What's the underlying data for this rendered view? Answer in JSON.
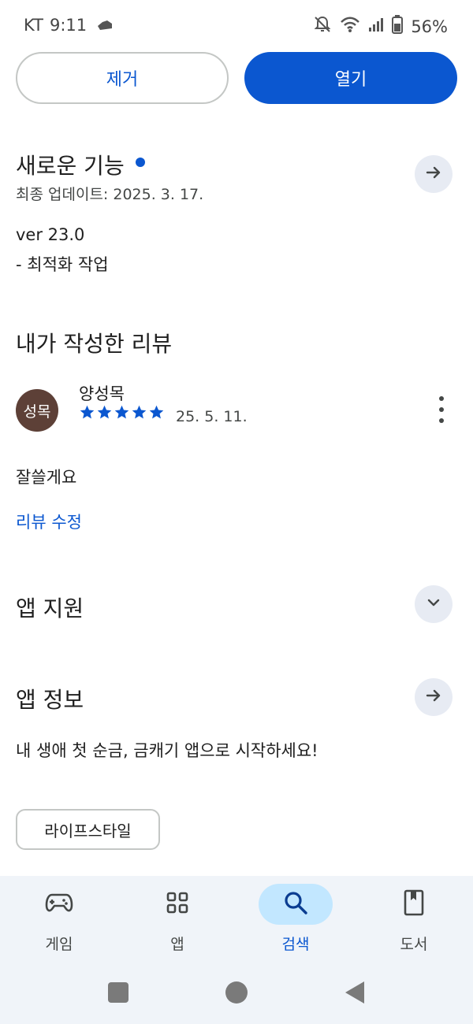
{
  "status_bar": {
    "carrier": "KT",
    "time": "9:11",
    "battery": "56%"
  },
  "actions": {
    "remove_label": "제거",
    "open_label": "열기"
  },
  "whats_new": {
    "title": "새로운 기능",
    "last_updated": "최종 업데이트: 2025. 3. 17.",
    "version": "ver 23.0",
    "notes": "- 최적화 작업"
  },
  "my_review": {
    "title": "내가 작성한 리뷰",
    "avatar_text": "성목",
    "reviewer": "양성목",
    "rating": 5,
    "date": "25. 5. 11.",
    "text": "잘쓸게요",
    "edit_link": "리뷰 수정"
  },
  "app_support": {
    "title": "앱 지원"
  },
  "app_info": {
    "title": "앱 정보",
    "description": "내 생애 첫 순금, 금캐기 앱으로 시작하세요!",
    "category_chip": "라이프스타일"
  },
  "bottom_nav": {
    "items": [
      {
        "label": "게임",
        "icon": "gamepad-icon"
      },
      {
        "label": "앱",
        "icon": "apps-grid-icon"
      },
      {
        "label": "검색",
        "icon": "search-icon"
      },
      {
        "label": "도서",
        "icon": "book-icon"
      }
    ],
    "active_index": 2
  },
  "colors": {
    "accent": "#0b57d0",
    "active_pill": "#c2e7ff",
    "avatar_bg": "#5d4037",
    "nav_bg": "#f0f4f9"
  }
}
